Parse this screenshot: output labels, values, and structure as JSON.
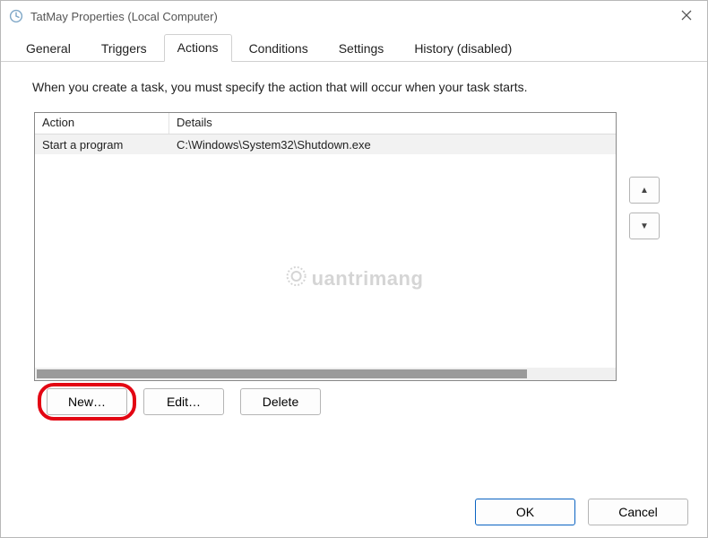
{
  "window": {
    "title": "TatMay Properties (Local Computer)"
  },
  "tabs": [
    {
      "label": "General",
      "active": false
    },
    {
      "label": "Triggers",
      "active": false
    },
    {
      "label": "Actions",
      "active": true
    },
    {
      "label": "Conditions",
      "active": false
    },
    {
      "label": "Settings",
      "active": false
    },
    {
      "label": "History (disabled)",
      "active": false
    }
  ],
  "panel": {
    "description": "When you create a task, you must specify the action that will occur when your task starts.",
    "columns": {
      "action": "Action",
      "details": "Details"
    },
    "actions": [
      {
        "action": "Start a program",
        "details": "C:\\Windows\\System32\\Shutdown.exe"
      }
    ],
    "buttons": {
      "new": "New…",
      "edit": "Edit…",
      "delete": "Delete"
    },
    "move": {
      "up": "▲",
      "down": "▼"
    }
  },
  "dialog": {
    "ok": "OK",
    "cancel": "Cancel"
  },
  "watermark": "uantrimang"
}
